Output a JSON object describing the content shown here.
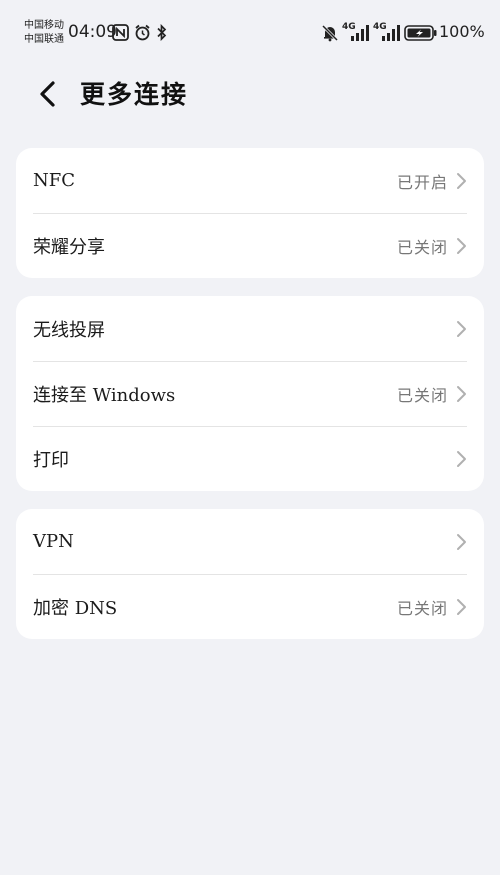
{
  "status_bar": {
    "carrier_line1": "中国移动",
    "carrier_line2": "中国联通",
    "time": "04:09",
    "signal1_label": "4G",
    "signal2_label": "4G",
    "battery": "100%",
    "icons": [
      "nfc-icon",
      "alarm-icon",
      "bluetooth-icon",
      "bell-off-icon",
      "signal-icon",
      "signal-icon",
      "battery-charging-icon"
    ]
  },
  "header": {
    "title": "更多连接"
  },
  "groups": [
    {
      "rows": [
        {
          "label": "NFC",
          "status": "已开启"
        },
        {
          "label": "荣耀分享",
          "status": "已关闭"
        }
      ]
    },
    {
      "rows": [
        {
          "label": "无线投屏",
          "status": ""
        },
        {
          "label": "连接至 Windows",
          "status": "已关闭"
        },
        {
          "label": "打印",
          "status": ""
        }
      ]
    },
    {
      "rows": [
        {
          "label": "VPN",
          "status": ""
        },
        {
          "label": "加密 DNS",
          "status": "已关闭"
        }
      ]
    }
  ]
}
